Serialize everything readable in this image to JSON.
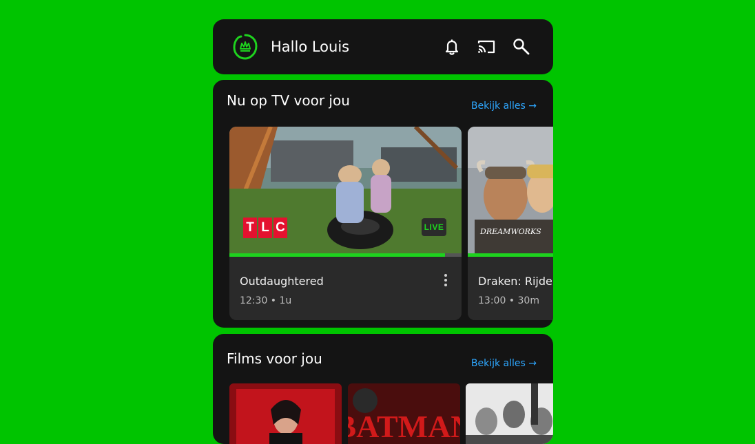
{
  "header": {
    "greeting": "Hallo Louis",
    "icons": [
      "kpn-logo-icon",
      "bell-icon",
      "cast-icon",
      "search-icon"
    ]
  },
  "tv_section": {
    "title": "Nu op TV voor jou",
    "see_all": "Bekijk alles →",
    "programs": [
      {
        "title": "Outdaughtered",
        "meta": "12:30 • 1u",
        "channel": "TLC",
        "badge": "LIVE",
        "progress": 0.93
      },
      {
        "title": "Draken: Rijders van Berk",
        "meta": "13:00 • 30m",
        "studio": "DREAMWORKS",
        "progress": 1.0
      }
    ]
  },
  "films_section": {
    "title": "Films voor jou",
    "see_all": "Bekijk alles →",
    "posters": [
      "john-wick-poster",
      "the-batman-poster",
      "film-poster-3"
    ],
    "poster2_text": "BATMAN"
  },
  "colors": {
    "background": "#00c400",
    "card": "#141414",
    "accent": "#1ed21e",
    "link": "#2ea7ff",
    "tlc_red": "#e4112f"
  }
}
